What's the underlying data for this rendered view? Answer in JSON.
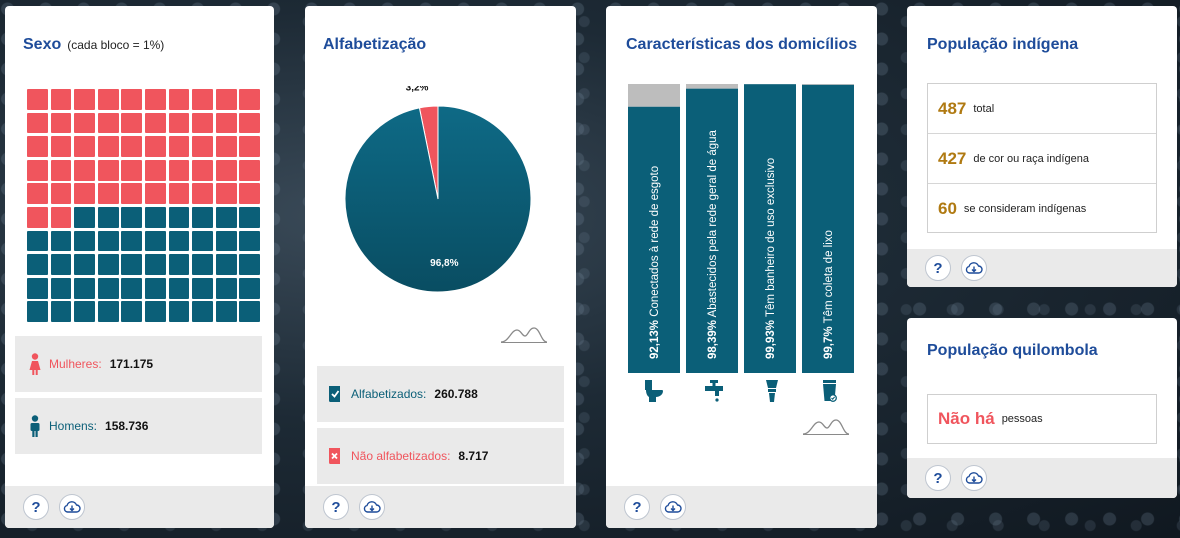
{
  "sexo": {
    "title": "Sexo",
    "subtitle": "(cada bloco = 1%)",
    "female_color": "#f0555d",
    "male_color": "#0b5f78",
    "female_blocks": 52,
    "mulheres_label": "Mulheres:",
    "mulheres_value": "171.175",
    "homens_label": "Homens:",
    "homens_value": "158.736"
  },
  "alfabetizacao": {
    "title": "Alfabetização",
    "alfabetizados_label": "Alfabetizados:",
    "alfabetizados_value": "260.788",
    "nao_label": "Não alfabetizados:",
    "nao_value": "8.717"
  },
  "domicilios": {
    "title": "Características dos domicílios"
  },
  "indigena": {
    "title": "População indígena",
    "rows": [
      {
        "num": "487",
        "text": "total"
      },
      {
        "num": "427",
        "text": "de cor ou raça indígena"
      },
      {
        "num": "60",
        "text": "se consideram indígenas"
      }
    ]
  },
  "quilombola": {
    "title": "População quilombola",
    "num": "Não há",
    "text": "pessoas"
  },
  "footer": {
    "help_label": "?"
  },
  "icons": [
    "female-icon",
    "male-icon",
    "book-check-icon",
    "book-x-icon",
    "toilet-icon",
    "faucet-icon",
    "shower-icon",
    "trash-can-icon",
    "help-icon",
    "cloud-download-icon",
    "distribution-curve-icon"
  ],
  "chart_data": [
    {
      "type": "pie",
      "categories": [
        "Alfabetizados",
        "Não alfabetizados"
      ],
      "values": [
        96.8,
        3.2
      ],
      "value_labels": [
        "96,8%",
        "3,2%"
      ],
      "colors": [
        "#0b5f78",
        "#f0555d"
      ]
    },
    {
      "type": "bar",
      "orientation": "vertical",
      "ylim": [
        0,
        100
      ],
      "categories": [
        "Conectados à rede de esgoto",
        "Abastecidos pela rede geral de água",
        "Têm banheiro de uso exclusivo",
        "Têm coleta de lixo"
      ],
      "values": [
        92.13,
        98.39,
        99.93,
        99.7
      ],
      "value_labels": [
        "92,13%",
        "98,39%",
        "99,93%",
        "99,7%"
      ],
      "bar_color": "#0b5f78",
      "remainder_color": "#bdbdbd"
    }
  ]
}
